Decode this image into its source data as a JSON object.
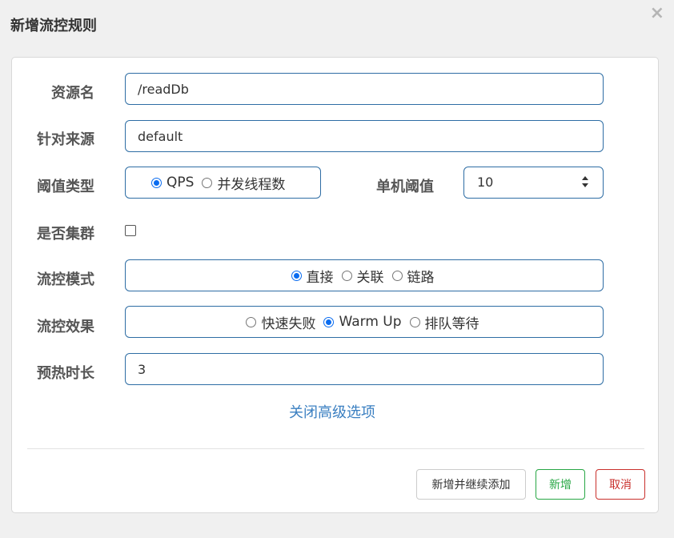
{
  "dialog": {
    "title": "新增流控规则",
    "close_glyph": "×"
  },
  "form": {
    "resource_label": "资源名",
    "resource_value": "/readDb",
    "source_label": "针对来源",
    "source_value": "default",
    "threshold_type_label": "阈值类型",
    "threshold_type_options": [
      "QPS",
      "并发线程数"
    ],
    "threshold_type_selected": "QPS",
    "single_threshold_label": "单机阈值",
    "single_threshold_value": "10",
    "cluster_label": "是否集群",
    "cluster_checked": false,
    "flow_mode_label": "流控模式",
    "flow_mode_options": [
      "直接",
      "关联",
      "链路"
    ],
    "flow_mode_selected": "直接",
    "flow_effect_label": "流控效果",
    "flow_effect_options": [
      "快速失败",
      "Warm Up",
      "排队等待"
    ],
    "flow_effect_selected": "Warm Up",
    "warmup_label": "预热时长",
    "warmup_value": "3"
  },
  "advanced_link": "关闭高级选项",
  "buttons": {
    "add_continue": "新增并继续添加",
    "add": "新增",
    "cancel": "取消"
  },
  "colors": {
    "input_border": "#2e6da4",
    "radio_checked": "#0a6cf0",
    "link": "#3a7fc1",
    "add_green": "#28a745",
    "cancel_red": "#c9302c"
  }
}
